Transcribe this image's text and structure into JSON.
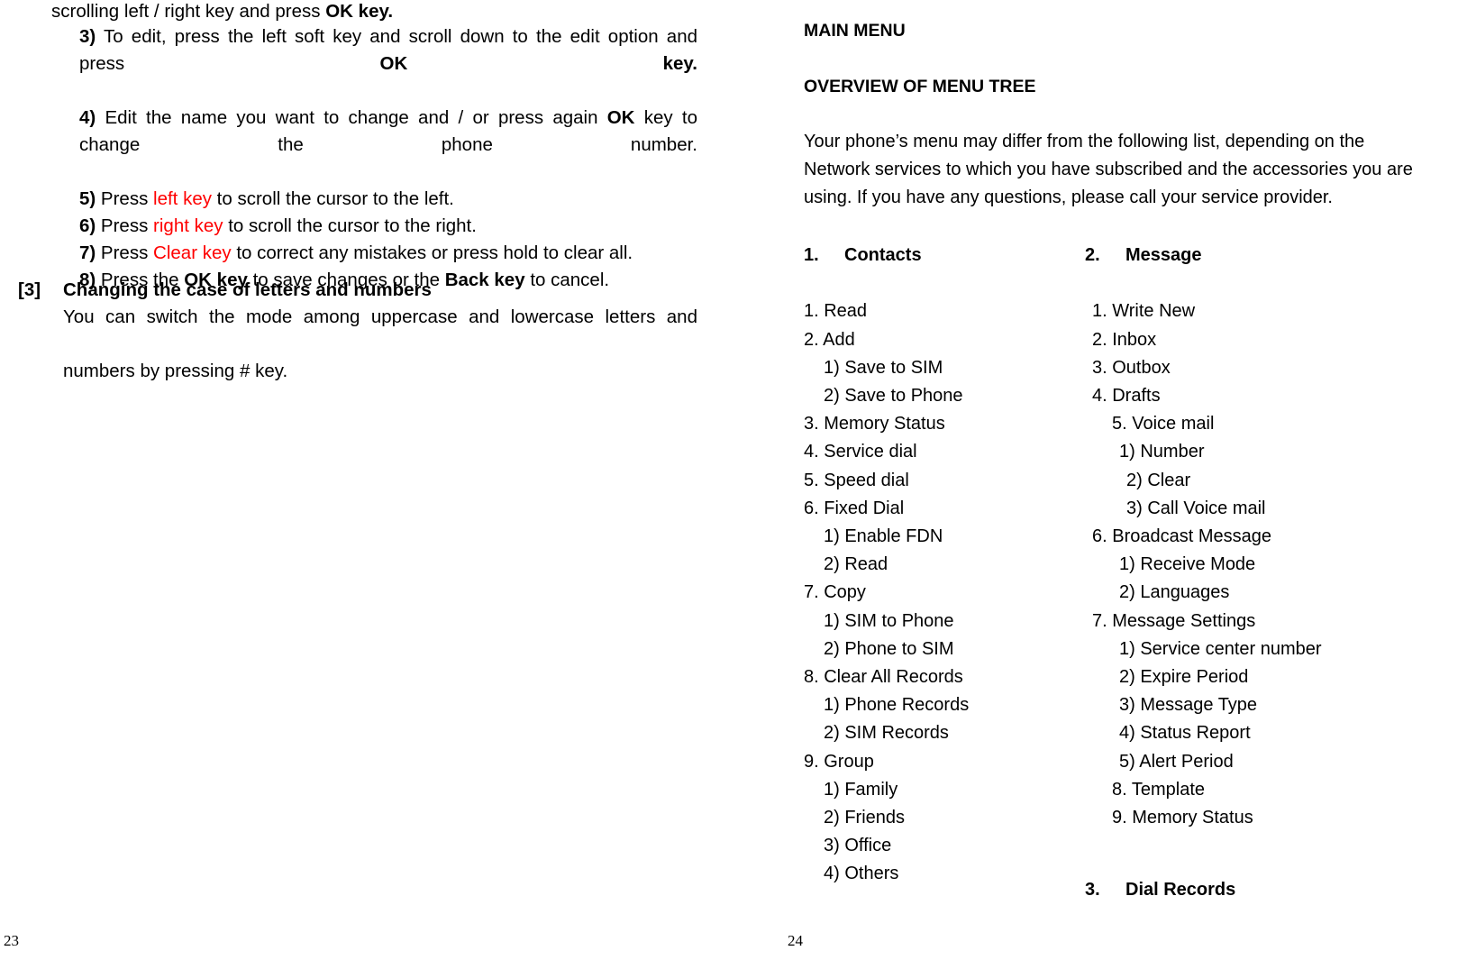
{
  "document": {
    "type": "mobile-phone-user-manual",
    "left_page_number": "23",
    "right_page_number": "24"
  },
  "left_page": {
    "lead_line": {
      "text_plain": "scrolling left / right key and press OK key.",
      "prefix": "scrolling left / right key and press ",
      "bold_tail": "OK key."
    },
    "steps": [
      {
        "num": "3)",
        "segments": [
          {
            "text": " To edit, press the left soft key and scroll down to the edit option and press ",
            "style": "normal"
          },
          {
            "text": "OK key.",
            "style": "bold"
          }
        ]
      },
      {
        "num": "4)",
        "segments": [
          {
            "text": " Edit the name you want to change and / or press again ",
            "style": "normal"
          },
          {
            "text": "OK",
            "style": "bold"
          },
          {
            "text": " key to change the phone number.",
            "style": "normal"
          }
        ]
      },
      {
        "num": "5)",
        "segments": [
          {
            "text": " Press ",
            "style": "normal"
          },
          {
            "text": "left key",
            "style": "red"
          },
          {
            "text": " to scroll the cursor to the left.",
            "style": "normal"
          }
        ]
      },
      {
        "num": "6)",
        "segments": [
          {
            "text": " Press ",
            "style": "normal"
          },
          {
            "text": "right key",
            "style": "red"
          },
          {
            "text": " to scroll the cursor to the right.",
            "style": "normal"
          }
        ]
      },
      {
        "num": "7)",
        "segments": [
          {
            "text": " Press ",
            "style": "normal"
          },
          {
            "text": "Clear key",
            "style": "red"
          },
          {
            "text": " to correct any mistakes or press hold to clear all.",
            "style": "normal"
          }
        ]
      },
      {
        "num": "8)",
        "segments": [
          {
            "text": " Press the ",
            "style": "normal"
          },
          {
            "text": "OK key",
            "style": "bold"
          },
          {
            "text": " to save changes or the ",
            "style": "normal"
          },
          {
            "text": "Back key",
            "style": "bold"
          },
          {
            "text": " to cancel.",
            "style": "normal"
          }
        ]
      }
    ],
    "section3": {
      "tag": "[3]",
      "title": "Changing the case of letters and numbers",
      "body_line1": "You can switch the mode among uppercase and lowercase letters and",
      "body_line2": "numbers by pressing # key."
    }
  },
  "right_page": {
    "headings": {
      "main_menu": "MAIN MENU",
      "overview": "OVERVIEW OF MENU TREE"
    },
    "intro": "Your phone’s menu may differ from the following list, depending on the Network services to which you have subscribed and the accessories you are using. If you have any questions, please call your service provider.",
    "menu_column_1": {
      "title_num": "1.",
      "title_label": "Contacts",
      "items": [
        {
          "text": "1. Read",
          "level": 1
        },
        {
          "text": "2. Add",
          "level": 1
        },
        {
          "text": "1) Save to SIM",
          "level": 2
        },
        {
          "text": "2) Save to Phone",
          "level": 2
        },
        {
          "text": "3. Memory Status",
          "level": 1
        },
        {
          "text": "4. Service dial",
          "level": 1
        },
        {
          "text": "5. Speed dial",
          "level": 1
        },
        {
          "text": "6. Fixed Dial",
          "level": 1
        },
        {
          "text": "1) Enable FDN",
          "level": 2
        },
        {
          "text": "2) Read",
          "level": 2
        },
        {
          "text": "7. Copy",
          "level": 1
        },
        {
          "text": "1) SIM to Phone",
          "level": 2
        },
        {
          "text": "2) Phone to SIM",
          "level": 2
        },
        {
          "text": "8. Clear All Records",
          "level": 1
        },
        {
          "text": "1) Phone Records",
          "level": 2
        },
        {
          "text": "2) SIM Records",
          "level": 2
        },
        {
          "text": "9. Group",
          "level": 1
        },
        {
          "text": "1) Family",
          "level": 2
        },
        {
          "text": "2) Friends",
          "level": 2
        },
        {
          "text": "3) Office",
          "level": 2
        },
        {
          "text": "4) Others",
          "level": 2
        }
      ]
    },
    "menu_column_2": {
      "title_num": "2.",
      "title_label": "Message",
      "items": [
        {
          "text": "1. Write New",
          "level": 1
        },
        {
          "text": "2. Inbox",
          "level": 1
        },
        {
          "text": "3. Outbox",
          "level": 1
        },
        {
          "text": "4. Drafts",
          "level": 1
        },
        {
          "text": "5. Voice mail",
          "level": 1,
          "indent": "ind1"
        },
        {
          "text": "1) Number",
          "level": 2,
          "indent": "ind2"
        },
        {
          "text": "2) Clear",
          "level": 2,
          "indent": "ind3"
        },
        {
          "text": "3) Call Voice mail",
          "level": 2,
          "indent": "ind4"
        },
        {
          "text": "6. Broadcast Message",
          "level": 1
        },
        {
          "text": "1) Receive Mode",
          "level": 2
        },
        {
          "text": "2) Languages",
          "level": 2
        },
        {
          "text": "7. Message Settings",
          "level": 1
        },
        {
          "text": "1) Service center number",
          "level": 2
        },
        {
          "text": "2) Expire Period",
          "level": 2
        },
        {
          "text": "3) Message Type",
          "level": 2
        },
        {
          "text": "4) Status Report",
          "level": 2
        },
        {
          "text": "5) Alert Period",
          "level": 2
        },
        {
          "text": "8. Template",
          "level": 1,
          "indent": "ind1"
        },
        {
          "text": "9. Memory Status",
          "level": 1,
          "indent": "ind1"
        }
      ]
    },
    "menu_column_3": {
      "title_num": "3.",
      "title_label": "Dial Records"
    }
  },
  "colors": {
    "text": "#000000",
    "highlight": "#ff0000",
    "background": "#ffffff"
  }
}
